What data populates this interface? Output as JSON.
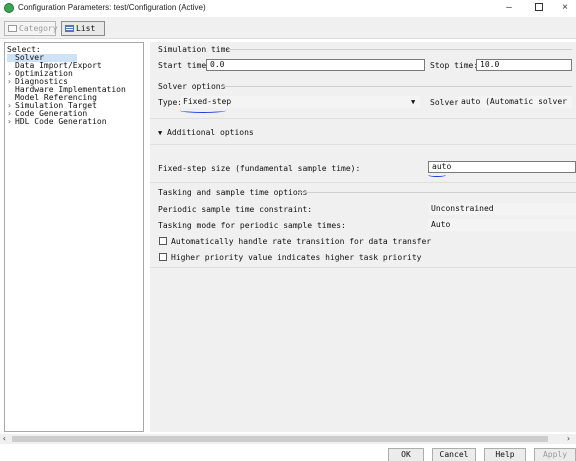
{
  "window": {
    "title": "Configuration Parameters: test/Configuration (Active)",
    "minimize_glyph": "–",
    "close_glyph": "×"
  },
  "toolbar": {
    "category_label": "Category",
    "list_label": "List"
  },
  "tree": {
    "title": "Select:",
    "items": [
      {
        "label": "Solver",
        "expandable": false,
        "selected": true
      },
      {
        "label": "Data Import/Export",
        "expandable": false
      },
      {
        "label": "Optimization",
        "expandable": true
      },
      {
        "label": "Diagnostics",
        "expandable": true
      },
      {
        "label": "Hardware Implementation",
        "expandable": false
      },
      {
        "label": "Model Referencing",
        "expandable": false
      },
      {
        "label": "Simulation Target",
        "expandable": true
      },
      {
        "label": "Code Generation",
        "expandable": true
      },
      {
        "label": "HDL Code Generation",
        "expandable": true
      }
    ]
  },
  "simulation_time": {
    "section_label": "Simulation time",
    "start_label": "Start time:",
    "start_value": "0.0",
    "stop_label": "Stop time:",
    "stop_value": "10.0"
  },
  "solver_options": {
    "section_label": "Solver options",
    "type_label": "Type:",
    "type_value": "Fixed-step",
    "solver_label": "Solver:",
    "solver_value": "auto (Automatic solver se"
  },
  "additional": {
    "toggle_label": "Additional options",
    "fixed_step_label": "Fixed-step size (fundamental sample time):",
    "fixed_step_value": "auto"
  },
  "tasking": {
    "section_label": "Tasking and sample time options",
    "periodic_label": "Periodic sample time constraint:",
    "periodic_value": "Unconstrained",
    "mode_label": "Tasking mode for periodic sample times:",
    "mode_value": "Auto",
    "auto_rate_label": "Automatically handle rate transition for data transfer",
    "auto_rate_checked": false,
    "higher_priority_label": "Higher priority value indicates higher task priority",
    "higher_priority_checked": false
  },
  "buttons": {
    "ok": "OK",
    "cancel": "Cancel",
    "help": "Help",
    "apply": "Apply"
  },
  "colors": {
    "annotation": "#1b3fd6",
    "selected_bg": "#cfe3f7",
    "app_icon": "#3aa655"
  }
}
